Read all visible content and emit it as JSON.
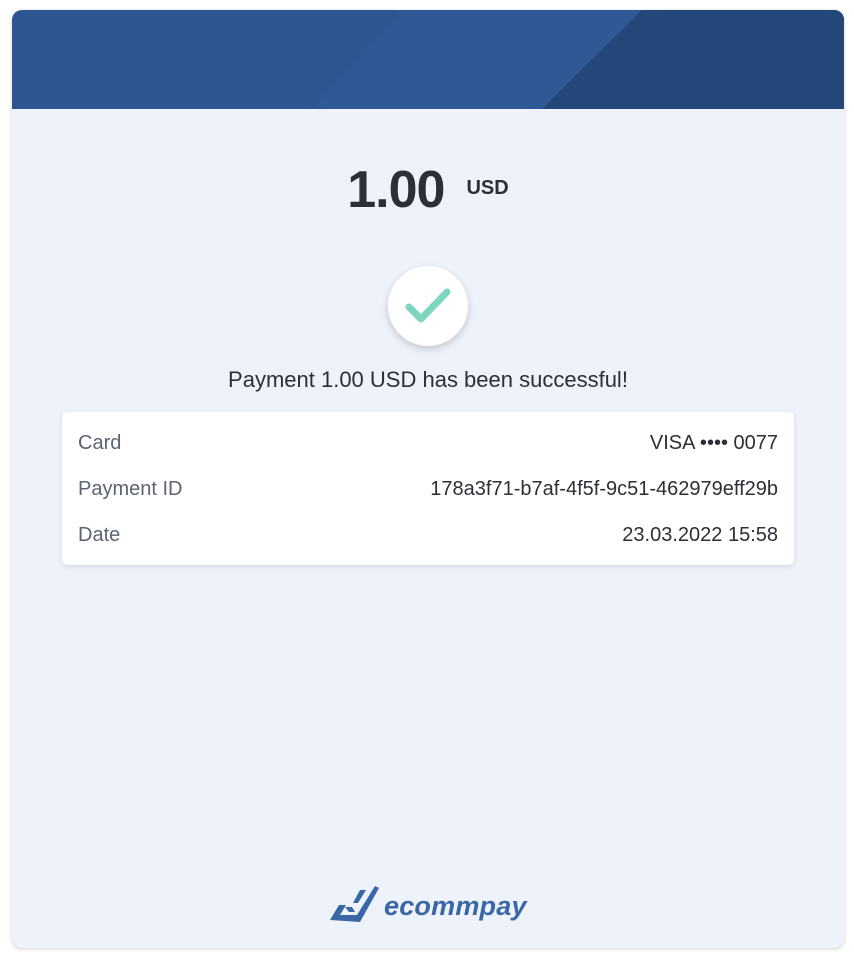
{
  "colors": {
    "header_dark": "#24477a",
    "header_mid": "#2c538e",
    "header_light": "#32599a",
    "background": "#eef2fa",
    "check": "#7ed6c0",
    "brand": "#3a67a6"
  },
  "payment": {
    "amount": "1.00",
    "currency": "USD",
    "status_icon": "checkmark-icon",
    "message": "Payment 1.00 USD has been successful!"
  },
  "details": [
    {
      "label": "Card",
      "value": "VISA •••• 0077"
    },
    {
      "label": "Payment ID",
      "value": "178a3f71-b7af-4f5f-9c51-462979eff29b"
    },
    {
      "label": "Date",
      "value": "23.03.2022 15:58"
    }
  ],
  "footer": {
    "logo_icon": "ecommpay-logo-icon",
    "brand_name": "ecommpay"
  }
}
